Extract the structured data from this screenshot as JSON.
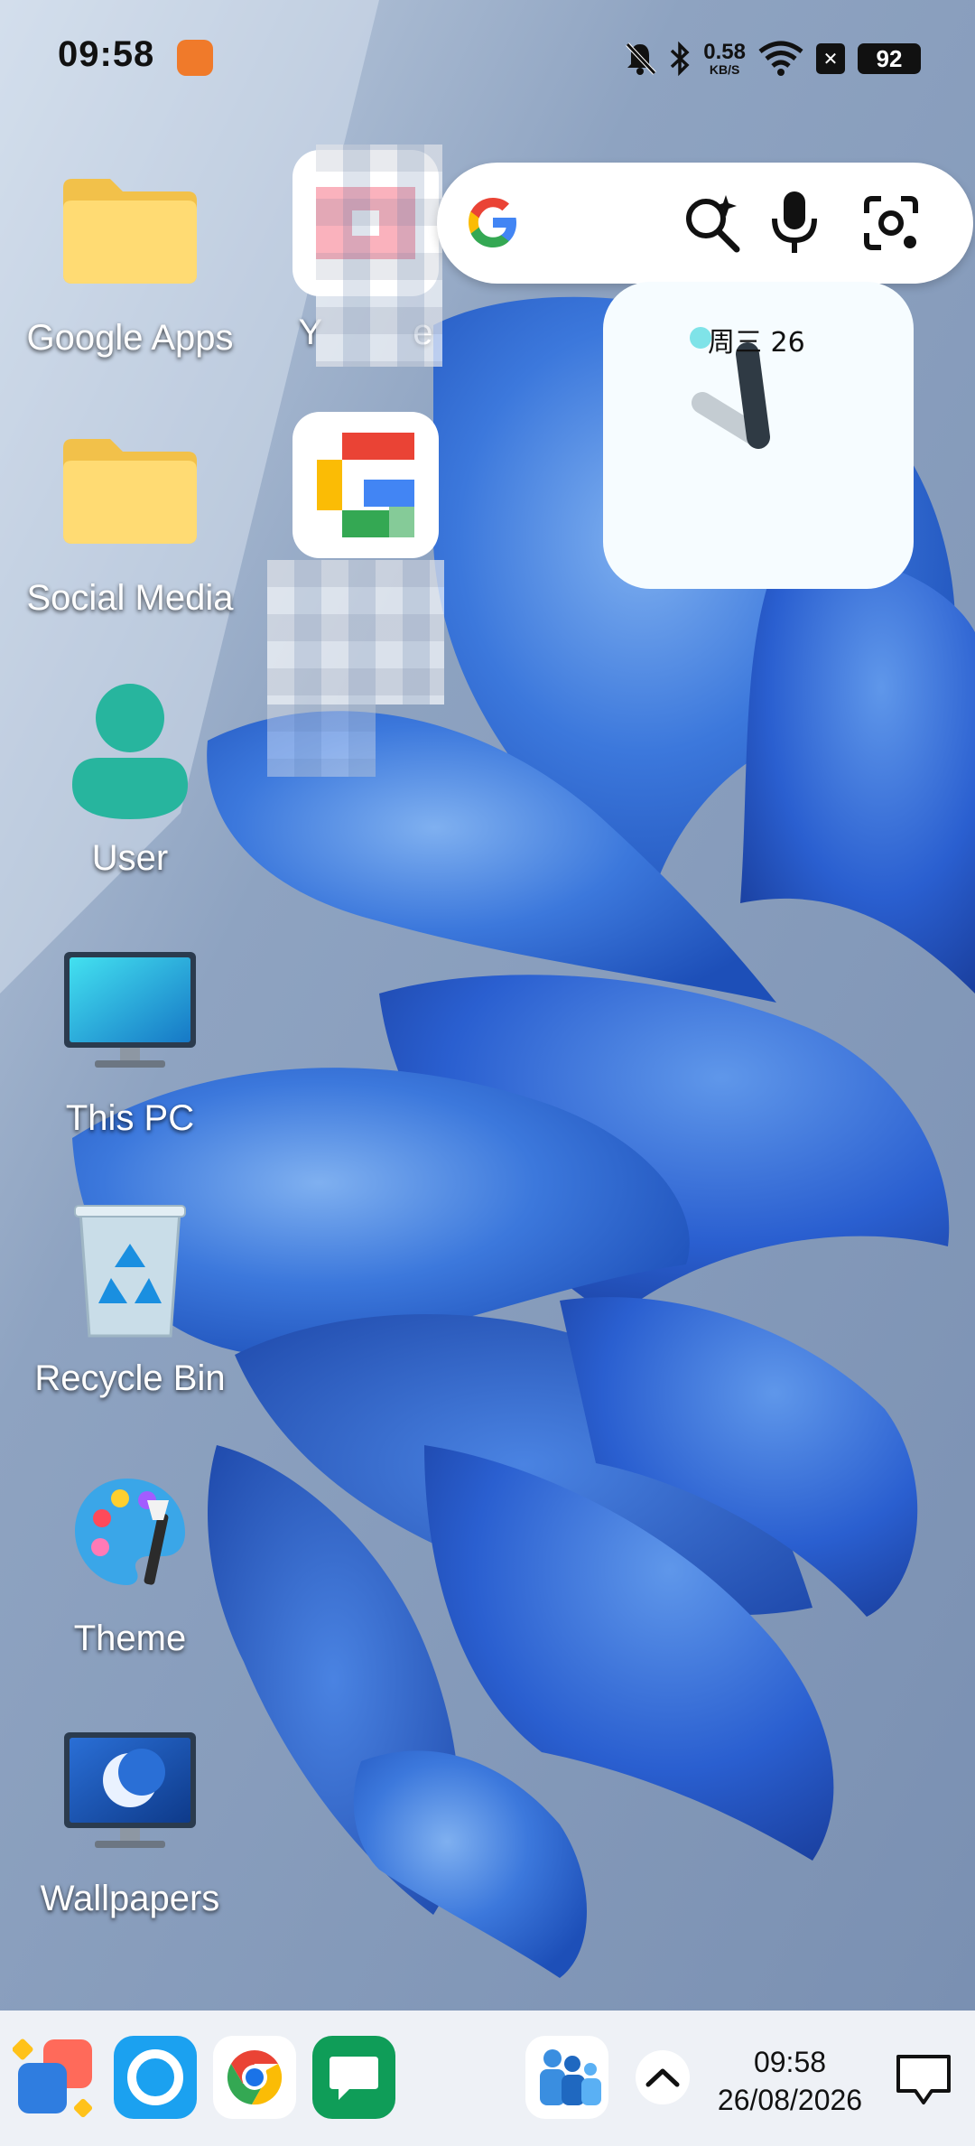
{
  "status_bar": {
    "time": "09:58",
    "net_speed_value": "0.58",
    "net_speed_unit": "KB/S",
    "battery": "92",
    "icons": [
      "app-notification-icon",
      "mute-bell-icon",
      "bluetooth-icon",
      "wifi-icon",
      "xbox-icon",
      "battery-icon"
    ]
  },
  "desktop": {
    "icons": [
      {
        "label": "Google Apps",
        "icon": "folder-icon"
      },
      {
        "label": "Social Media",
        "icon": "folder-icon"
      },
      {
        "label": "User",
        "icon": "user-icon"
      },
      {
        "label": "This PC",
        "icon": "monitor-icon"
      },
      {
        "label": "Recycle Bin",
        "icon": "recycle-bin-icon"
      },
      {
        "label": "Theme",
        "icon": "palette-icon"
      },
      {
        "label": "Wallpapers",
        "icon": "wallpaper-icon"
      }
    ],
    "pinned_apps": [
      {
        "label": "Y",
        "label_tail": "e",
        "icon": "youtube-icon"
      },
      {
        "label": "",
        "icon": "google-icon"
      }
    ]
  },
  "search_widget": {
    "icons": [
      "google-g-icon",
      "ai-search-icon",
      "microphone-icon",
      "lens-camera-icon"
    ]
  },
  "clock_widget": {
    "date": "周三 26"
  },
  "taskbar": {
    "apps": [
      "app-drawer-icon",
      "browser-circle-icon",
      "chrome-icon",
      "messages-icon",
      "people-icon"
    ],
    "time": "09:58",
    "date": "26/08/2026"
  },
  "colors": {
    "taskbar_bg": "#eef1f6",
    "wallpaper_base": "#6f86a8",
    "petal_blue": "#2a5fd0"
  }
}
